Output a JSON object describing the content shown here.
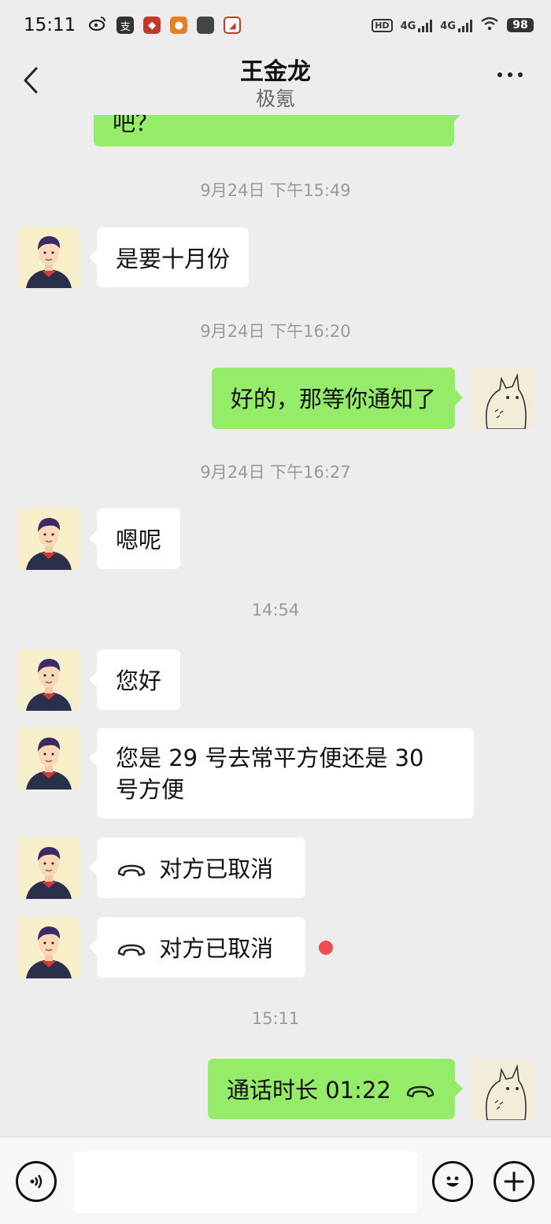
{
  "status_bar": {
    "time": "15:11",
    "hd": "HD",
    "net1": "4G",
    "net2": "4G",
    "battery": "98"
  },
  "header": {
    "title": "王金龙",
    "subtitle": "极氪"
  },
  "messages": {
    "partial": "吧？",
    "ts1": "9月24日 下午15:49",
    "m1": "是要十月份",
    "ts2": "9月24日 下午16:20",
    "m2": "好的，那等你通知了",
    "ts3": "9月24日 下午16:27",
    "m3": "嗯呢",
    "ts4": "14:54",
    "m4": "您好",
    "m5_line1": "您是 29 号去常平方便还是 30",
    "m5_line2": "号方便",
    "m6": "对方已取消",
    "m7": "对方已取消",
    "ts5": "15:11",
    "m8": "通话时长 01:22"
  },
  "input": {
    "placeholder": ""
  },
  "colors": {
    "background": "#ededed",
    "outgoing_bubble": "#95ec69",
    "incoming_bubble": "#ffffff",
    "unread_dot": "#f04d4d"
  },
  "icons": {
    "back": "back-arrow-icon",
    "more": "more-icon",
    "call": "phone-hangup-icon",
    "voice": "voice-icon",
    "emoji": "emoji-icon",
    "plus": "plus-icon"
  }
}
